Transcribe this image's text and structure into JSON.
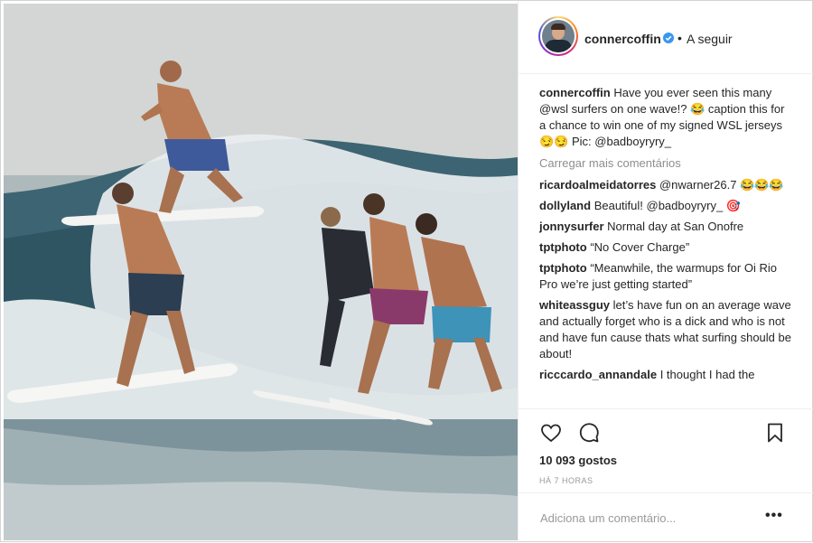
{
  "header": {
    "username": "connercoffin",
    "separator": "•",
    "follow_label": "A seguir"
  },
  "caption": {
    "user": "connercoffin",
    "text": "Have you ever seen this many @wsl surfers on one wave!? 😂 caption this for a chance to win one of my signed WSL jerseys 😏😏 Pic: @badboyryry_"
  },
  "load_more": "Carregar mais comentários",
  "comments": [
    {
      "user": "ricardoalmeidatorres",
      "text": "@nwarner26.7 😂😂😂"
    },
    {
      "user": "dollyland",
      "text": "Beautiful! @badboyryry_ 🎯"
    },
    {
      "user": "jonnysurfer",
      "text": "Normal day at San Onofre"
    },
    {
      "user": "tptphoto",
      "text": "“No Cover Charge”"
    },
    {
      "user": "tptphoto",
      "text": "“Meanwhile, the warmups for Oi Rio Pro we’re just getting started”"
    },
    {
      "user": "whiteassguy",
      "text": "let’s have fun on an average wave and actually forget who is a dick and who is not and have fun cause thats what surfing should be about!"
    },
    {
      "user": "ricccardo_annandale",
      "text": "I thought I had the"
    }
  ],
  "icons": {
    "like": "heart-icon",
    "comment": "comment-icon",
    "save": "bookmark-icon",
    "verified": "verified-badge-icon",
    "more": "more-options-icon"
  },
  "likes": "10 093 gostos",
  "time_ago": "HÁ 7 HORAS",
  "add_comment": {
    "placeholder": "Adiciona um comentário...",
    "more_label": "•••"
  },
  "colors": {
    "verified": "#3897f0",
    "muted_text": "#8e8e8e",
    "text": "#262626"
  }
}
